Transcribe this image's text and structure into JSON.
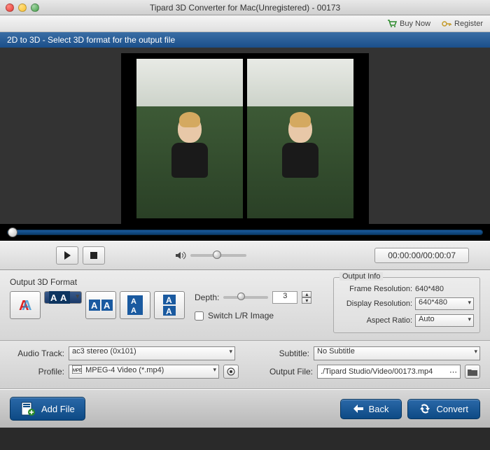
{
  "window": {
    "title": "Tipard 3D Converter for Mac(Unregistered) - 00173"
  },
  "toolbar": {
    "buy": "Buy Now",
    "register": "Register"
  },
  "bluebar": {
    "text": "2D to 3D - Select 3D format for the output file"
  },
  "playback": {
    "time": "00:00:00/00:00:07"
  },
  "format": {
    "label": "Output 3D Format",
    "depth_label": "Depth:",
    "depth_value": "3",
    "switch_label": "Switch L/R Image"
  },
  "output_info": {
    "legend": "Output Info",
    "frame_label": "Frame Resolution:",
    "frame_value": "640*480",
    "display_label": "Display Resolution:",
    "display_value": "640*480",
    "aspect_label": "Aspect Ratio:",
    "aspect_value": "Auto"
  },
  "settings": {
    "audio_label": "Audio Track:",
    "audio_value": "ac3 stereo (0x101)",
    "subtitle_label": "Subtitle:",
    "subtitle_value": "No Subtitle",
    "profile_label": "Profile:",
    "profile_value": "MPEG-4 Video (*.mp4)",
    "output_label": "Output File:",
    "output_value": "./Tipard Studio/Video/00173.mp4"
  },
  "buttons": {
    "add": "Add File",
    "back": "Back",
    "convert": "Convert"
  }
}
